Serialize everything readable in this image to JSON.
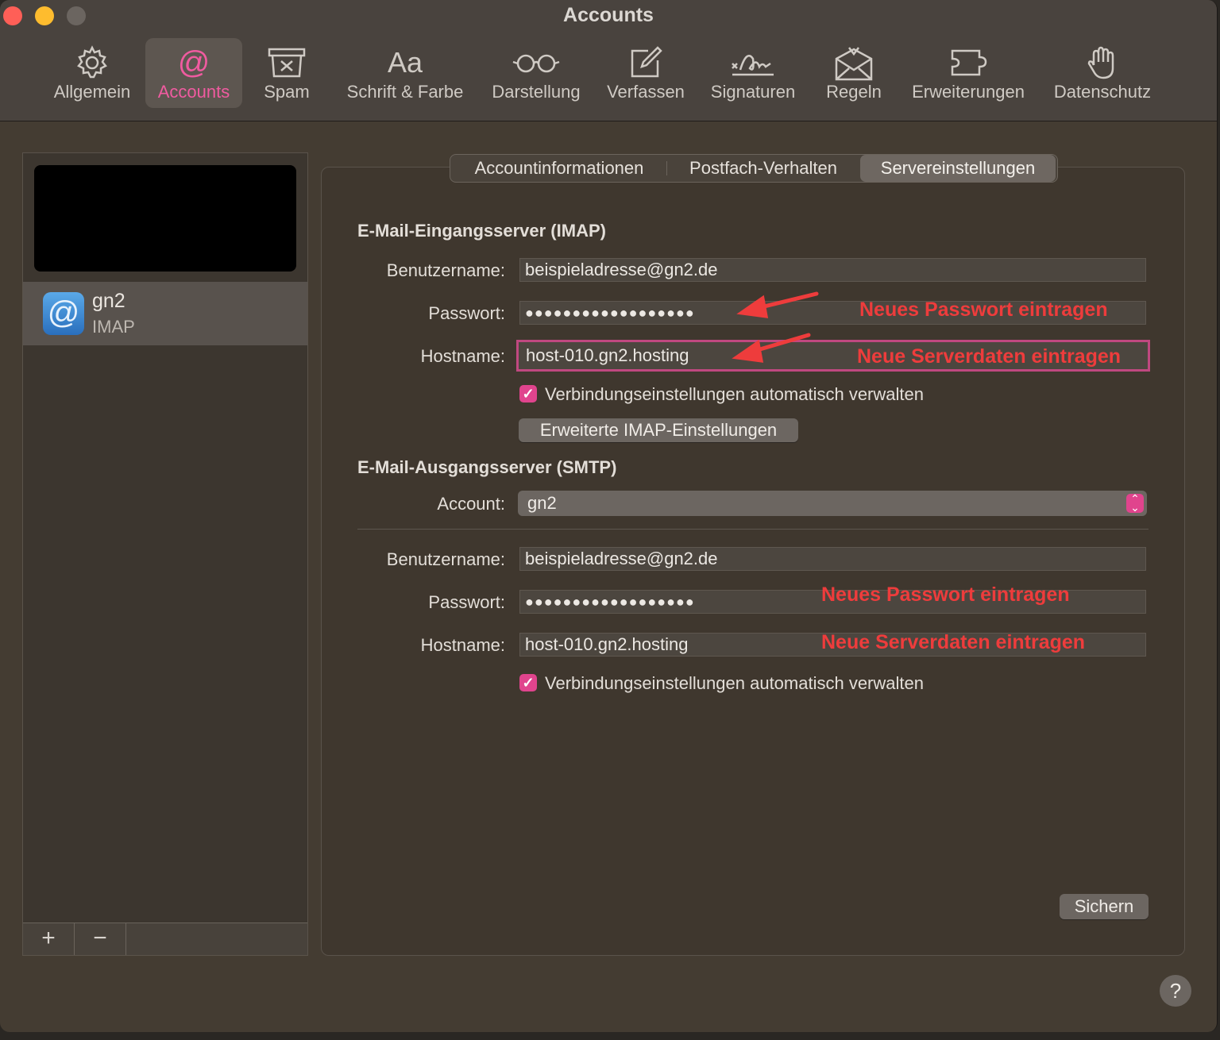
{
  "window": {
    "title": "Accounts"
  },
  "toolbar": {
    "items": [
      {
        "label": "Allgemein",
        "icon": "gear-icon"
      },
      {
        "label": "Accounts",
        "icon": "at-sign-icon",
        "active": true
      },
      {
        "label": "Spam",
        "icon": "junk-bin-icon"
      },
      {
        "label": "Schrift & Farbe",
        "icon": "font-icon",
        "glyph": "Aa"
      },
      {
        "label": "Darstellung",
        "icon": "glasses-icon"
      },
      {
        "label": "Verfassen",
        "icon": "compose-icon"
      },
      {
        "label": "Signaturen",
        "icon": "signature-icon"
      },
      {
        "label": "Regeln",
        "icon": "rules-envelope-icon"
      },
      {
        "label": "Erweiterungen",
        "icon": "extension-icon"
      },
      {
        "label": "Datenschutz",
        "icon": "hand-icon"
      }
    ],
    "accent_color": "#f05ba0"
  },
  "sidebar": {
    "account": {
      "name": "gn2",
      "type": "IMAP",
      "icon_glyph": "@"
    },
    "add_label": "+",
    "remove_label": "−"
  },
  "tabs": [
    {
      "label": "Accountinformationen"
    },
    {
      "label": "Postfach-Verhalten"
    },
    {
      "label": "Servereinstellungen",
      "active": true
    }
  ],
  "imap": {
    "title": "E-Mail-Eingangsserver (IMAP)",
    "username_label": "Benutzername:",
    "username": "beispieladresse@gn2.de",
    "password_label": "Passwort:",
    "password": "●●●●●●●●●●●●●●●●●●",
    "hostname_label": "Hostname:",
    "hostname": "host-010.gn2.hosting",
    "auto_manage_label": "Verbindungseinstellungen automatisch verwalten",
    "advanced_button": "Erweiterte IMAP-Einstellungen"
  },
  "smtp": {
    "title": "E-Mail-Ausgangsserver (SMTP)",
    "account_label": "Account:",
    "account_value": "gn2",
    "username_label": "Benutzername:",
    "username": "beispieladresse@gn2.de",
    "password_label": "Passwort:",
    "password": "●●●●●●●●●●●●●●●●●●",
    "hostname_label": "Hostname:",
    "hostname": "host-010.gn2.hosting",
    "auto_manage_label": "Verbindungseinstellungen automatisch verwalten"
  },
  "annotations": {
    "imap_password": "Neues Passwort eintragen",
    "imap_hostname": "Neue Serverdaten eintragen",
    "smtp_password": "Neues Passwort eintragen",
    "smtp_hostname": "Neue Serverdaten eintragen",
    "color": "#ee3c3c"
  },
  "save_button": "Sichern",
  "help_button": "?"
}
